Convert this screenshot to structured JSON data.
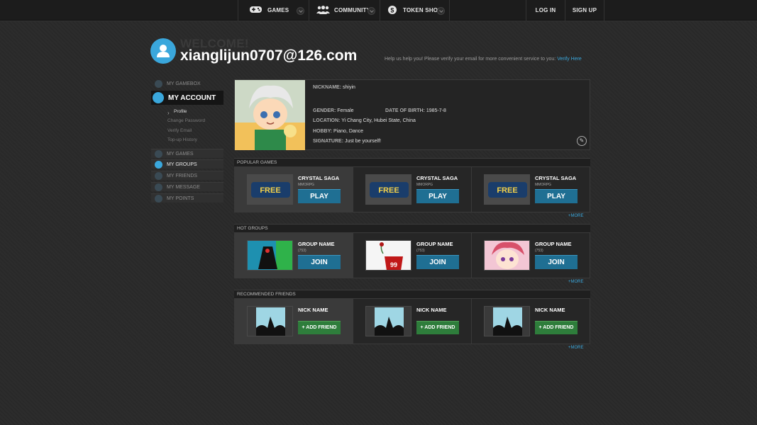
{
  "nav": {
    "games": "GAMES",
    "community": "COMMUNITY",
    "token_shop": "TOKEN SHOP",
    "login": "LOG IN",
    "signup": "SIGN UP"
  },
  "header": {
    "welcome": "WELCOME!",
    "email": "xianglijun0707@126.com",
    "verify_msg": "Help us help you! Please verify your email for more convenient service to you:",
    "verify_link": "Verify Here"
  },
  "sidebar": {
    "my_gamebox": "MY GAMEBOX",
    "my_account": "MY ACCOUNT",
    "profile": "Profile",
    "change_password": "Change Password",
    "verify_email": "Verify Email",
    "topup_history": "Top-up History",
    "my_games": "MY GAMES",
    "my_groups": "MY GROUPS",
    "my_friends": "MY FRIENDS",
    "my_message": "MY MESSAGE",
    "my_points": "MY POINTS"
  },
  "profile": {
    "nickname_label": "NICKNAME:",
    "nickname": "shiyin",
    "gender_label": "GENDER:",
    "gender": "Female",
    "dob_label": "DATE OF BIRTH:",
    "dob": "1985-7-8",
    "location_label": "LOCATION:",
    "location": "Yi Chang City, Hubei State, China",
    "hobby_label": "HOBBY:",
    "hobby": "Piano, Dance",
    "signature_label": "SIGNATURE:",
    "signature": "Just be yourself!"
  },
  "popular_games": {
    "title": "POPULAR GAMES",
    "more": "+MORE",
    "items": [
      {
        "name": "CRYSTAL SAGA",
        "genre": "MMORPG",
        "button": "PLAY",
        "logo_text": "FREE"
      },
      {
        "name": "CRYSTAL SAGA",
        "genre": "MMORPG",
        "button": "PLAY",
        "logo_text": "FREE"
      },
      {
        "name": "CRYSTAL SAGA",
        "genre": "MMORPG",
        "button": "PLAY",
        "logo_text": "FREE"
      }
    ]
  },
  "hot_groups": {
    "title": "HOT GROUPS",
    "more": "+MORE",
    "items": [
      {
        "name": "GROUP NAME",
        "count": "(753)",
        "button": "JOIN"
      },
      {
        "name": "GROUP NAME",
        "count": "(753)",
        "button": "JOIN",
        "thumb_text": "99"
      },
      {
        "name": "GROUP NAME",
        "count": "(753)",
        "button": "JOIN"
      }
    ]
  },
  "recommended_friends": {
    "title": "RECOMMENDED FRIENDS",
    "more": "+MORE",
    "items": [
      {
        "name": "NICK NAME",
        "button": "+ ADD FRIEND"
      },
      {
        "name": "NICK NAME",
        "button": "+ ADD FRIEND"
      },
      {
        "name": "NICK NAME",
        "button": "+ ADD FRIEND"
      }
    ]
  }
}
